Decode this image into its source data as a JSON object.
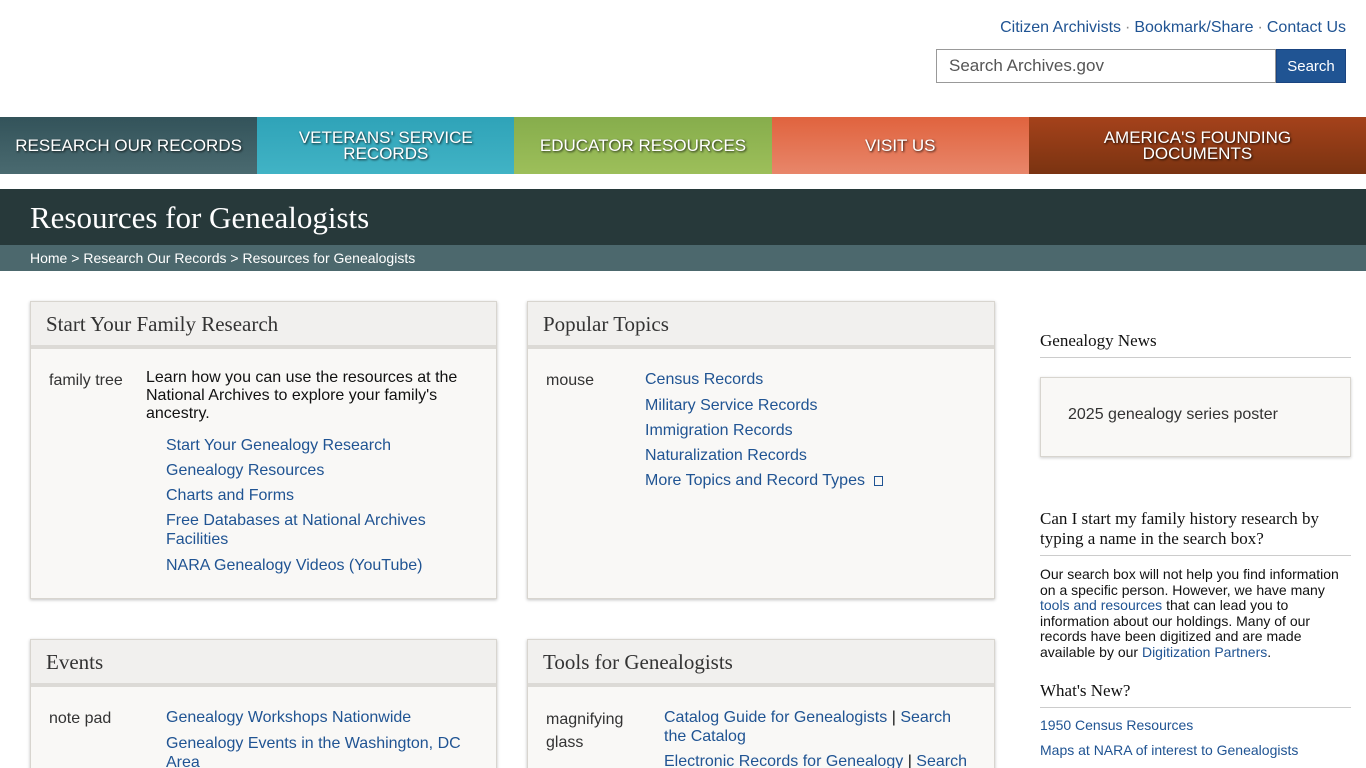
{
  "utility": {
    "links": [
      "Citizen Archivists",
      "Bookmark/Share",
      "Contact Us"
    ],
    "separator": "·"
  },
  "search": {
    "placeholder": "Search Archives.gov",
    "button": "Search"
  },
  "nav": [
    "RESEARCH OUR RECORDS",
    "VETERANS' SERVICE RECORDS",
    "EDUCATOR RESOURCES",
    "VISIT US",
    "AMERICA'S FOUNDING DOCUMENTS"
  ],
  "page": {
    "title": "Resources for Genealogists",
    "breadcrumb": [
      "Home",
      "Research Our Records",
      "Resources for Genealogists"
    ],
    "breadcrumb_sep": ">"
  },
  "panels": {
    "family": {
      "title": "Start Your Family Research",
      "img_alt": "family tree",
      "intro": "Learn how you can use the resources at the National Archives to explore your family's ancestry.",
      "links": [
        "Start Your Genealogy Research",
        "Genealogy Resources",
        "Charts and Forms",
        "Free Databases at National Archives Facilities",
        "NARA Genealogy Videos (YouTube)"
      ]
    },
    "topics": {
      "title": "Popular Topics",
      "img_alt": "mouse",
      "links": [
        "Census Records",
        "Military Service Records",
        "Immigration Records",
        "Naturalization Records",
        "More Topics and Record Types"
      ]
    },
    "events": {
      "title": "Events",
      "img_alt": "note pad",
      "links": [
        "Genealogy Workshops Nationwide",
        "Genealogy Events in the Washington, DC Area"
      ]
    },
    "tools": {
      "title": "Tools for Genealogists",
      "img_alt": "magnifying glass",
      "links": [
        "Catalog Guide for Genealogists",
        "Search the Catalog",
        "Electronic Records for Genealogy",
        "Search"
      ],
      "pipe": "|"
    }
  },
  "sidebar": {
    "news_title": "Genealogy News",
    "poster_alt": "2025 genealogy series poster",
    "faq_title": "Can I start my family history research by typing a name in the search box?",
    "faq_text_1": "Our search box will not help you find information on a specific person.  However, we have many ",
    "faq_link_1": "tools and resources",
    "faq_text_2": " that can lead you to information about our holdings.  Many of our records have been digitized and are made available by our ",
    "faq_link_2": "Digitization Partners",
    "faq_text_3": ".",
    "whats_new_title": "What's New?",
    "whats_new_links": [
      "1950 Census Resources",
      "Maps at NARA of interest to Genealogists"
    ]
  }
}
